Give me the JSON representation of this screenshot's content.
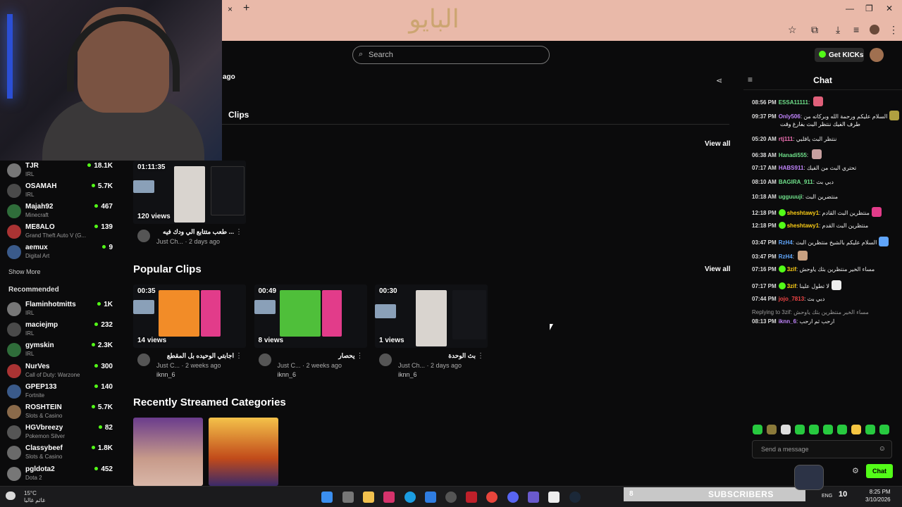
{
  "browser": {
    "close_tab": "×",
    "new_tab": "+",
    "win_min": "—",
    "win_max": "❐",
    "win_close": "✕"
  },
  "header": {
    "search_placeholder": "Search",
    "logo_text": "البايو",
    "get_kicks": "Get KICKs",
    "stream_ago": "ago"
  },
  "profile_tabs": {
    "clips": "Clips"
  },
  "sidebar": {
    "following": [
      {
        "name": "TJR",
        "category": "IRL",
        "viewers": "18.1K"
      },
      {
        "name": "OSAMAH",
        "category": "IRL",
        "viewers": "5.7K"
      },
      {
        "name": "Majah92",
        "category": "Minecraft",
        "viewers": "467"
      },
      {
        "name": "ME8ALO",
        "category": "Grand Theft Auto V (G...",
        "viewers": "139"
      },
      {
        "name": "aemux",
        "category": "Digital Art",
        "viewers": "9"
      }
    ],
    "show_more": "Show More",
    "recommended_title": "Recommended",
    "recommended": [
      {
        "name": "Flaminhotmitts",
        "category": "IRL",
        "viewers": "1K"
      },
      {
        "name": "maciejmp",
        "category": "IRL",
        "viewers": "232"
      },
      {
        "name": "gymskin",
        "category": "IRL",
        "viewers": "2.3K"
      },
      {
        "name": "NurVes",
        "category": "Call of Duty: Warzone",
        "viewers": "300"
      },
      {
        "name": "GPEP133",
        "category": "Fortnite",
        "viewers": "140"
      },
      {
        "name": "ROSHTEIN",
        "category": "Slots & Casino",
        "viewers": "5.7K"
      },
      {
        "name": "HGVbreezy",
        "category": "Pokemon Silver",
        "viewers": "82"
      },
      {
        "name": "Classybeef",
        "category": "Slots & Casino",
        "viewers": "1.8K"
      },
      {
        "name": "pgldota2",
        "category": "Dota 2",
        "viewers": "452"
      }
    ]
  },
  "main": {
    "view_all": "View all",
    "latest_clip": {
      "duration": "01:11:35",
      "views": "120 views",
      "title": "... طعب متتابع الي ودك فيه",
      "meta": "Just Ch... · 2 days ago"
    },
    "popular_title": "Popular Clips",
    "popular": [
      {
        "duration": "00:35",
        "views": "14 views",
        "title": "اجابتي الوحيده بل المقطع",
        "meta": "Just C... · 2 weeks ago",
        "author": "iknn_6"
      },
      {
        "duration": "00:49",
        "views": "8 views",
        "title": "يحصار",
        "meta": "Just C... · 2 weeks ago",
        "author": "iknn_6"
      },
      {
        "duration": "00:30",
        "views": "1 views",
        "title": "بث الوحدة",
        "meta": "Just Ch... · 2 days ago",
        "author": "iknn_6"
      }
    ],
    "categories_title": "Recently Streamed Categories"
  },
  "chat": {
    "title": "Chat",
    "messages": [
      {
        "time": "08:56 PM",
        "user": "ESSA11111",
        "color": "#6fe08a",
        "text": ""
      },
      {
        "time": "09:37 PM",
        "user": "Only506",
        "color": "#c084fc",
        "text": "السلام عليكم ورحمة الله وبركاته من"
      },
      {
        "time": "",
        "user": "",
        "color": "#fff",
        "text": "طرف الفيك ننتظر البث بفارغ وقت"
      },
      {
        "time": "05:20 AM",
        "user": "rtj111",
        "color": "#f472b6",
        "text": "ننتظر البث ياقلبي"
      },
      {
        "time": "06:38 AM",
        "user": "Hanadi555",
        "color": "#6fe08a",
        "text": ""
      },
      {
        "time": "07:17 AM",
        "user": "HABS911",
        "color": "#c084fc",
        "text": "تحتري البث من الفيك"
      },
      {
        "time": "08:10 AM",
        "user": "BAGIRA_911",
        "color": "#6fe08a",
        "text": "دبي بث"
      },
      {
        "time": "10:18 AM",
        "user": "ugguuuji",
        "color": "#6fe08a",
        "text": "منتضرين البث"
      },
      {
        "time": "12:18 PM",
        "user": "sheshtawy1",
        "color": "#facc15",
        "text": "منتظرين البث القادم"
      },
      {
        "time": "12:18 PM",
        "user": "sheshtawy1",
        "color": "#facc15",
        "text": "منتظرين البث القدم"
      },
      {
        "time": "03:47 PM",
        "user": "RzH4",
        "color": "#60a5fa",
        "text": "السلام عليكم بالشيخ منتظرين البث"
      },
      {
        "time": "03:47 PM",
        "user": "RzH4",
        "color": "#60a5fa",
        "text": ""
      },
      {
        "time": "07:16 PM",
        "user": "3zif",
        "color": "#facc15",
        "text": "مساء الخير منتظرين بثك ياوحش"
      },
      {
        "time": "07:17 PM",
        "user": "3zif",
        "color": "#facc15",
        "text": "لا تطول علينا"
      },
      {
        "time": "07:44 PM",
        "user": "jojo_7813",
        "color": "#ef4444",
        "text": "دبي بث"
      },
      {
        "time": "",
        "user": "",
        "color": "#9a9a9a",
        "text": "Replying to 3zif: مساء الخير منتظرين بثك ياوحش"
      },
      {
        "time": "08:13 PM",
        "user": "iknn_6",
        "color": "#c084fc",
        "text": "ارحب ثم ارحب"
      }
    ],
    "input_placeholder": "Send a message",
    "send_label": "Chat"
  },
  "overlay": {
    "subscribers_count": "8",
    "subscribers_label": "SUBSCRIBERS"
  },
  "taskbar": {
    "temp": "15°C",
    "weather_text": "غائم غالبا",
    "lang": "ENG",
    "sys_number": "10",
    "time": "8:25 PM",
    "date": "3/10/2026"
  },
  "colors": {
    "accent": "#53fc18",
    "tab_bg": "#e9b9a9"
  }
}
